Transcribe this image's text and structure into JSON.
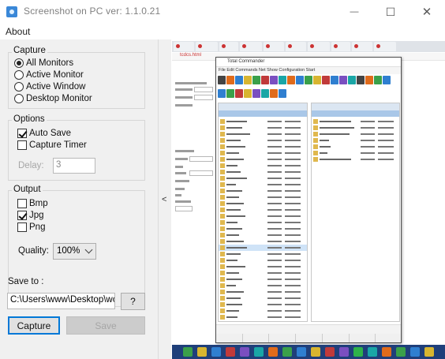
{
  "window": {
    "title": "Screenshot on PC ver: 1.1.0.21",
    "minimize_glyph": "—",
    "maximize_glyph": "☐",
    "close_glyph": "✕"
  },
  "menu": {
    "about": "About"
  },
  "capture": {
    "legend": "Capture",
    "options": [
      "All Monitors",
      "Active Monitor",
      "Active Window",
      "Desktop Monitor"
    ],
    "selected": "All Monitors"
  },
  "options": {
    "legend": "Options",
    "auto_save": {
      "label": "Auto Save",
      "checked": true
    },
    "capture_timer": {
      "label": "Capture Timer",
      "checked": false
    },
    "delay_label": "Delay:",
    "delay_value": "3"
  },
  "output": {
    "legend": "Output",
    "formats": [
      {
        "label": "Bmp",
        "checked": false
      },
      {
        "label": "Jpg",
        "checked": true
      },
      {
        "label": "Png",
        "checked": false
      }
    ],
    "quality_label": "Quality:",
    "quality_value": "100%"
  },
  "save": {
    "label": "Save to :",
    "path": "C:\\Users\\www\\Desktop\\wc",
    "help_button": "?"
  },
  "buttons": {
    "capture": "Capture",
    "save": "Save"
  },
  "splitter": {
    "arrow": "<"
  },
  "preview": {
    "browser_address": "tcdcs.html",
    "filemanager_title": "Total Commander",
    "filemanager_menu": "File Edit Commands Net Show Configuration Start"
  },
  "colors": {
    "accent": "#0078d7",
    "panel_bg": "#f0f0f0",
    "taskbar": "#1f3f7a"
  }
}
